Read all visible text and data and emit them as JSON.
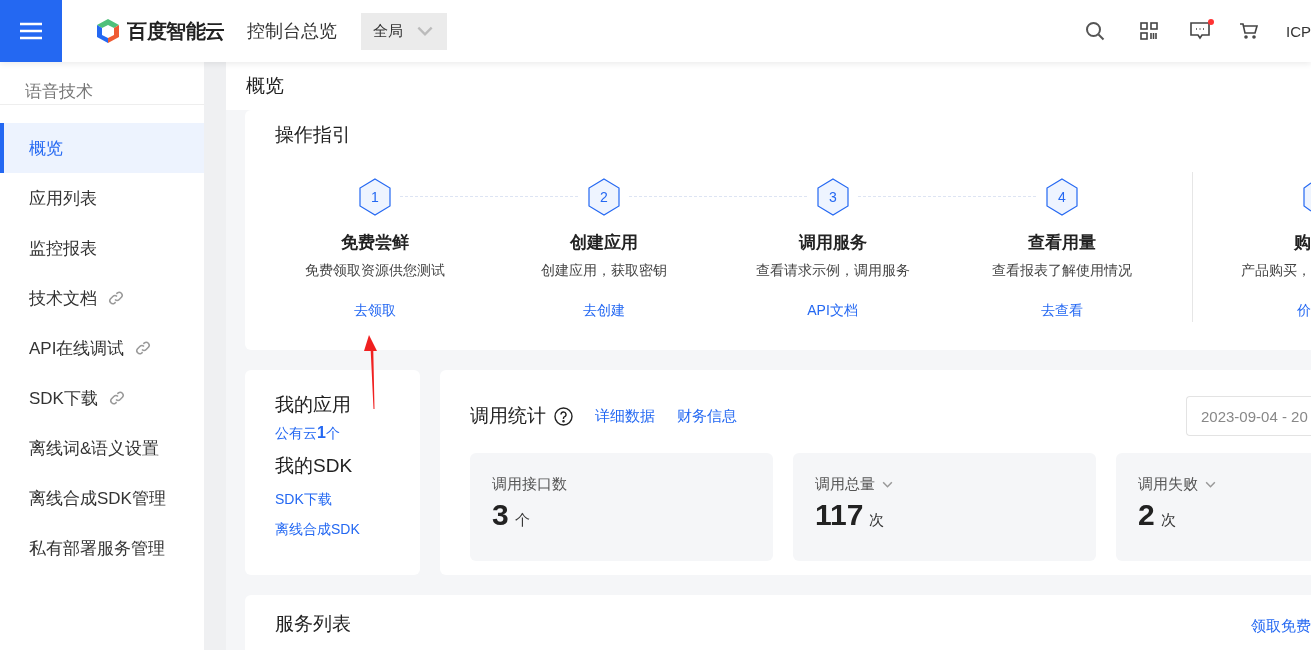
{
  "topbar": {
    "brand": "百度智能云",
    "title": "控制台总览",
    "scope": {
      "value": "全局"
    },
    "notification_dot": true,
    "account": "ICP"
  },
  "sidebar": {
    "title": "语音技术",
    "items": [
      {
        "label": "概览",
        "selected": true,
        "external": false
      },
      {
        "label": "应用列表",
        "selected": false,
        "external": false
      },
      {
        "label": "监控报表",
        "selected": false,
        "external": false
      },
      {
        "label": "技术文档",
        "selected": false,
        "external": true
      },
      {
        "label": "API在线调试",
        "selected": false,
        "external": true
      },
      {
        "label": "SDK下载",
        "selected": false,
        "external": true
      },
      {
        "label": "离线词&语义设置",
        "selected": false,
        "external": false
      },
      {
        "label": "离线合成SDK管理",
        "selected": false,
        "external": false
      },
      {
        "label": "私有部署服务管理",
        "selected": false,
        "external": false
      }
    ]
  },
  "page": {
    "title": "概览"
  },
  "guide": {
    "title": "操作指引",
    "steps": [
      {
        "number": "1",
        "title": "免费尝鲜",
        "description": "免费领取资源供您测试",
        "link": "去领取"
      },
      {
        "number": "2",
        "title": "创建应用",
        "description": "创建应用，获取密钥",
        "link": "去创建"
      },
      {
        "number": "3",
        "title": "调用服务",
        "description": "查看请求示例，调用服务",
        "link": "API文档"
      },
      {
        "number": "4",
        "title": "查看用量",
        "description": "查看报表了解使用情况",
        "link": "去查看"
      }
    ],
    "extra_step": {
      "title": "购",
      "description": "产品购买，",
      "link": "价"
    }
  },
  "apps": {
    "title": "我的应用",
    "public_cloud": "公有云**1**个",
    "sdk_title": "我的SDK",
    "links": [
      "SDK下载",
      "离线合成SDK"
    ]
  },
  "stats": {
    "title": "调用统计",
    "links": [
      "详细数据",
      "财务信息"
    ],
    "date_range": "2023-09-04 - 20",
    "metrics": [
      {
        "label": "调用接口数",
        "dropdown": false,
        "value": "3",
        "unit": "个"
      },
      {
        "label": "调用总量",
        "dropdown": true,
        "value": "117",
        "unit": "次"
      },
      {
        "label": "调用失败",
        "dropdown": true,
        "value": "2",
        "unit": "次"
      }
    ]
  },
  "services": {
    "title": "服务列表",
    "link": "领取免费"
  }
}
